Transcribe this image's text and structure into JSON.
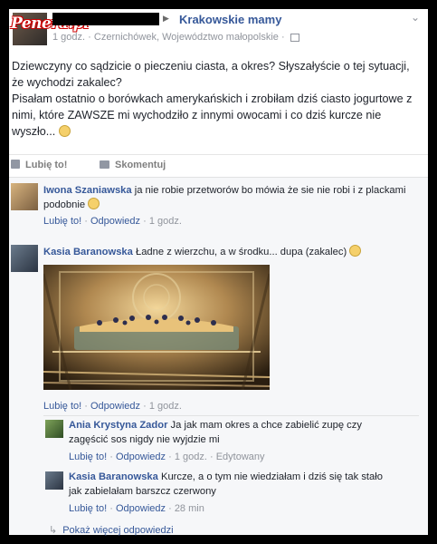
{
  "post": {
    "group_name": "Krakowskie mamy",
    "time": "1 godz.",
    "location": "Czernichówek, Województwo małopolskie",
    "text_line1": "Dziewczyny co sądzicie o pieczeniu ciasta, a okres? Słyszałyście o tej sytuacji, że wychodzi zakalec?",
    "text_line2": "Pisałam ostatnio o borówkach amerykańskich i zrobiłam dziś ciasto jogurtowe z nimi, które ZAWSZE mi wychodziło z innymi owocami i co dziś kurcze nie wyszło...",
    "like_label": "Lubię to!",
    "comment_label": "Skomentuj"
  },
  "watermark": "Penera.pl",
  "comments": [
    {
      "author": "Iwona Szaniawska",
      "text": "ja nie robie przetworów bo mówia że sie nie robi i z plackami podobnie",
      "like": "Lubię to!",
      "reply": "Odpowiedz",
      "time": "1 godz."
    },
    {
      "author": "Kasia Baranowska",
      "text": "Ładne z wierzchu, a w środku... dupa (zakalec)",
      "like": "Lubię to!",
      "reply": "Odpowiedz",
      "time": "1 godz."
    }
  ],
  "replies": [
    {
      "author": "Ania Krystyna Zador",
      "text": "Ja jak mam okres a chce zabielić zupę czy zagęścić sos nigdy nie wyjdzie mi",
      "like": "Lubię to!",
      "reply": "Odpowiedz",
      "time": "1 godz.",
      "edited": "Edytowany"
    },
    {
      "author": "Kasia Baranowska",
      "text": "Kurcze, a o tym nie wiedziałam i dziś się tak stało jak zabielałam barszcz czerwony",
      "like": "Lubię to!",
      "reply": "Odpowiedz",
      "time": "28 min"
    }
  ],
  "more_replies": "Pokaż więcej odpowiedzi",
  "colors": {
    "link": "#365899",
    "meta": "#90949c",
    "comments_bg": "#f6f7f9"
  },
  "icons": [
    "privacy-icon",
    "thumbs-up-icon",
    "comment-icon",
    "smiley-icon",
    "reply-arrow-icon",
    "chevron-down-icon"
  ]
}
